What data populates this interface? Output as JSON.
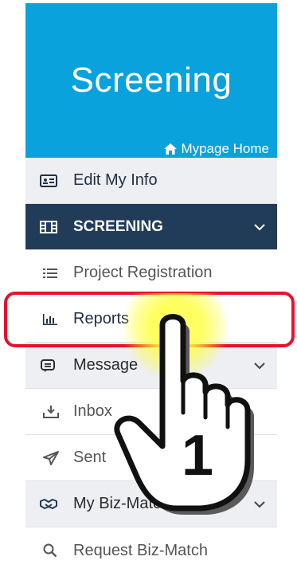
{
  "header": {
    "title": "Screening",
    "home_link": "Mypage Home"
  },
  "menu": {
    "edit_info": "Edit My Info",
    "screening": "SCREENING",
    "project_registration": "Project Registration",
    "reports": "Reports",
    "message": "Message",
    "inbox": "Inbox",
    "sent": "Sent",
    "biz_match": "My Biz-Match",
    "request_biz_match": "Request Biz-Match"
  },
  "annotation": {
    "step_number": "1"
  },
  "colors": {
    "header_bg": "#0aa2dc",
    "section_bg": "#213c59",
    "highlight": "#e8112d"
  }
}
